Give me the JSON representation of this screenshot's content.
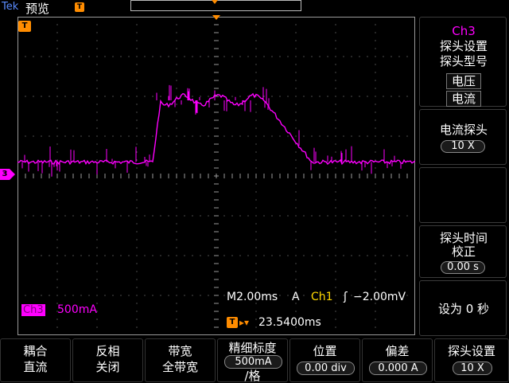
{
  "topbar": {
    "brand": "Tek",
    "mode": "预览",
    "trigger_marker": "T"
  },
  "graticule": {
    "trigger_marker": "T",
    "ground_marker": "3",
    "channel_badge": "Ch3",
    "channel_scale": "500mA",
    "timebase": "M2.00ms",
    "acq_mode": "A",
    "trigger_source": "Ch1",
    "trigger_slope": "ʃ",
    "trigger_level": "−2.00mV",
    "delay_marker": "T",
    "delay_arrow": "▸▾",
    "delay_value": "23.5400ms"
  },
  "trace": {
    "color": "#ff00ff",
    "description_levels": {
      "baseline_divisions": 0.35,
      "high_divisions": 1.9
    }
  },
  "side_menu": {
    "channel": "Ch3",
    "probe_setup": "探头设置",
    "probe_type": "探头型号",
    "opt_voltage": "电压",
    "opt_current": "电流",
    "current_probe": "电流探头",
    "current_probe_value": "10 X",
    "deskew_l1": "探头时间",
    "deskew_l2": "校正",
    "deskew_value": "0.00 s",
    "set_zero": "设为 0 秒"
  },
  "bottom_menu": {
    "coupling_l1": "耦合",
    "coupling_l2": "直流",
    "invert_l1": "反相",
    "invert_l2": "关闭",
    "bandwidth_l1": "带宽",
    "bandwidth_l2": "全带宽",
    "fine_scale_l1": "精细标度",
    "fine_scale_value": "500mA",
    "fine_scale_l3": "/格",
    "position_l1": "位置",
    "position_value": "0.00 div",
    "offset_l1": "偏差",
    "offset_value": "0.000 A",
    "probe_setup_l1": "探头设置",
    "probe_setup_value": "10 X"
  },
  "colors": {
    "channel3": "#ff00ff",
    "trigger": "#ff8c00",
    "channel1": "#ffd700",
    "grid": "#9a9a9a"
  }
}
